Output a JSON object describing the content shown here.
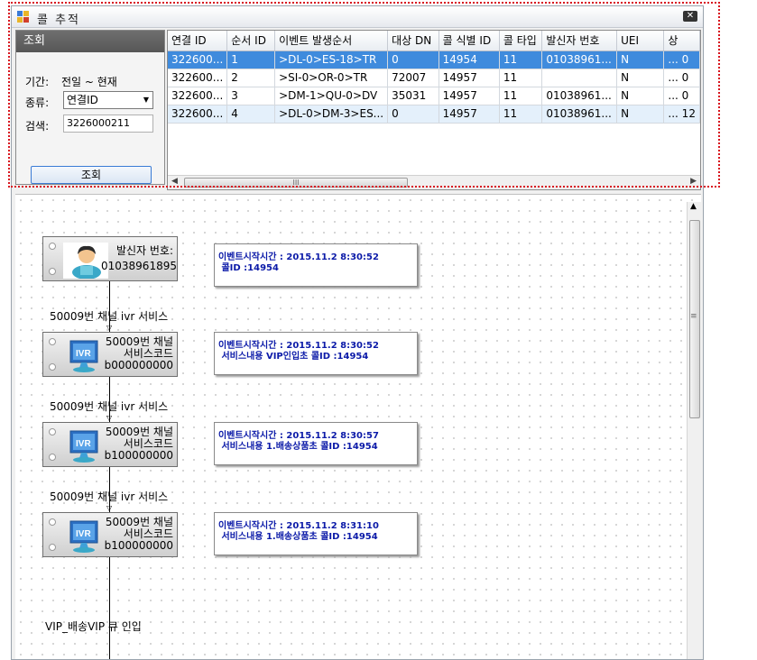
{
  "window": {
    "title": "콜 추적"
  },
  "query_panel": {
    "header": "조회",
    "period_label": "기간:",
    "period_value": "전일 ~ 현재",
    "type_label": "종류:",
    "type_selected": "연결ID",
    "search_label": "검색:",
    "search_value": "3226000211",
    "query_button": "조회"
  },
  "grid": {
    "columns": [
      "연결 ID",
      "순서 ID",
      "이벤트 발생순서",
      "대상 DN",
      "콜 식별 ID",
      "콜 타입",
      "발신자 번호",
      "UEI",
      "상"
    ],
    "rows": [
      [
        "322600...",
        "1",
        ">DL-0>ES-18>TR",
        "0",
        "14954",
        "11",
        "01038961...",
        "N",
        "... 0"
      ],
      [
        "322600...",
        "2",
        ">SI-0>OR-0>TR",
        "72007",
        "14957",
        "11",
        "",
        "N",
        "... 0"
      ],
      [
        "322600...",
        "3",
        ">DM-1>QU-0>DV",
        "35031",
        "14957",
        "11",
        "01038961...",
        "N",
        "... 0"
      ],
      [
        "322600...",
        "4",
        ">DL-0>DM-3>ES...",
        "0",
        "14957",
        "11",
        "01038961...",
        "N",
        "... 12"
      ]
    ],
    "selected_row": 0,
    "scroll_grip": "III"
  },
  "diagram": {
    "nodes": [
      {
        "type": "caller",
        "icon": "person-icon",
        "text": "발신자 번호:\n01038961895"
      },
      {
        "type": "ivr",
        "icon": "ivr-monitor-icon",
        "text": "50009번 채널\n서비스코드\nb000000000"
      },
      {
        "type": "ivr",
        "icon": "ivr-monitor-icon",
        "text": "50009번 채널\n서비스코드\nb100000000"
      },
      {
        "type": "ivr",
        "icon": "ivr-monitor-icon",
        "text": "50009번 채널\n서비스코드\nb100000000"
      }
    ],
    "info_boxes": [
      "이벤트시작시간 : 2015.11.2 8:30:52\n 콜ID :14954",
      "이벤트시작시간 : 2015.11.2 8:30:52\n 서비스내용 VIP인입초 콜ID :14954",
      "이벤트시작시간 : 2015.11.2 8:30:57\n 서비스내용 1.배송상품초 콜ID :14954",
      "이벤트시작시간 : 2015.11.2 8:31:10\n 서비스내용 1.배송상품초 콜ID :14954"
    ],
    "edge_labels": [
      "50009번 채널 ivr 서비스",
      "50009번 채널 ivr 서비스",
      "50009번 채널 ivr 서비스"
    ],
    "bottom_label": "VIP_배송VIP 큐 인입",
    "ivr_icon_text": "IVR"
  },
  "colors": {
    "selection": "#3f8bdd",
    "info_text": "#0b1aa8",
    "highlight_border": "#d8141e",
    "panel_header": "#626262"
  }
}
